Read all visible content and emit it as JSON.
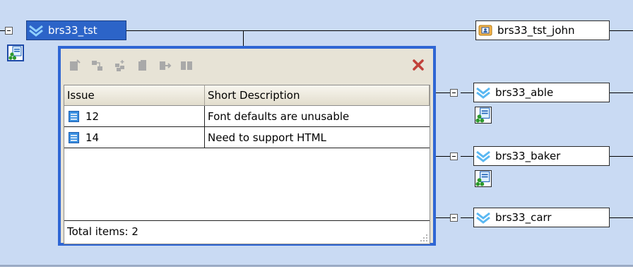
{
  "colors": {
    "canvas_bg": "#c9daf3",
    "selection": "#2c64c8",
    "popup_border": "#2f66d4",
    "close_icon": "#c1413a"
  },
  "tree": {
    "root": {
      "label": "brs33_tst",
      "icon": "stream-icon",
      "selected": true
    },
    "parent": {
      "label": "brs33_tst_john",
      "icon": "workspace-icon"
    },
    "children": [
      {
        "label": "brs33_able",
        "icon": "stream-icon"
      },
      {
        "label": "brs33_baker",
        "icon": "stream-icon"
      },
      {
        "label": "brs33_carr",
        "icon": "stream-icon"
      }
    ]
  },
  "popup": {
    "toolbar_icons": [
      "new-issue-icon",
      "move-icon",
      "add-issues-icon",
      "edit-icon",
      "promote-icon",
      "split-icon"
    ],
    "close_icon": "close-icon",
    "columns": [
      "Issue",
      "Short Description"
    ],
    "rows": [
      {
        "issue": "12",
        "description": "Font defaults are unusable"
      },
      {
        "issue": "14",
        "description": "Need to support HTML"
      }
    ],
    "status": "Total items: 2"
  }
}
